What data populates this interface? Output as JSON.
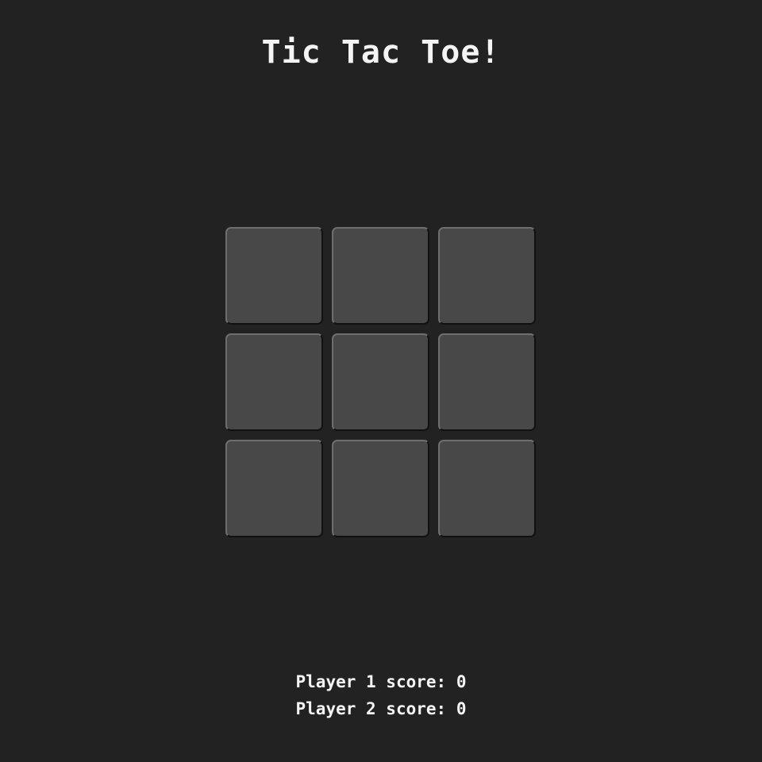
{
  "title": "Tic Tac Toe!",
  "board": {
    "cells": [
      "",
      "",
      "",
      "",
      "",
      "",
      "",
      "",
      ""
    ]
  },
  "scores": {
    "player1_label": "Player 1 score: ",
    "player1_value": "0",
    "player2_label": "Player 2 score: ",
    "player2_value": "0"
  },
  "colors": {
    "background": "#222222",
    "cell": "#484848",
    "text": "#f4f4f4"
  }
}
